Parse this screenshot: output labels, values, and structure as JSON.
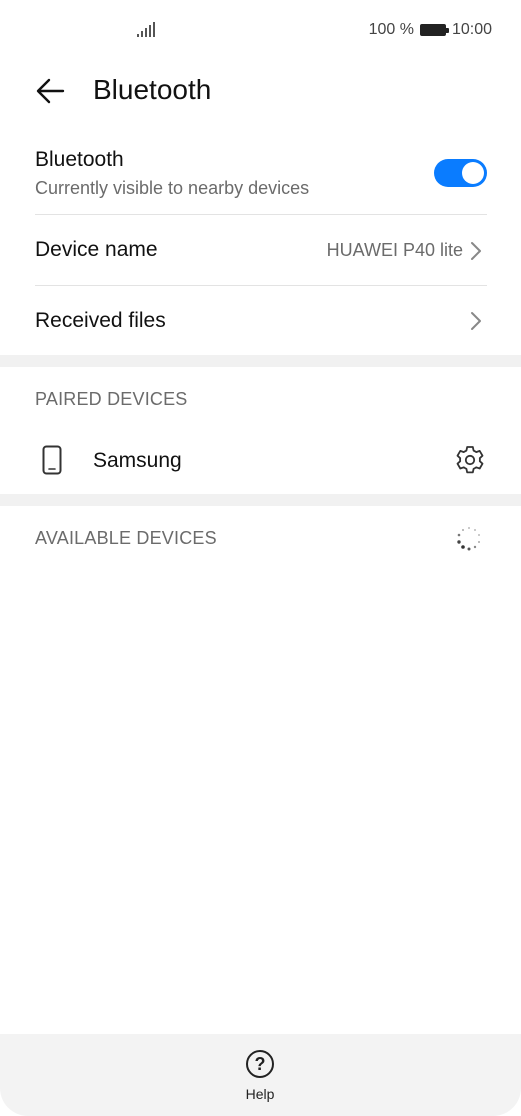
{
  "status_bar": {
    "battery_text": "100 %",
    "time": "10:00"
  },
  "header": {
    "title": "Bluetooth"
  },
  "bluetooth_row": {
    "title": "Bluetooth",
    "subtitle": "Currently visible to nearby devices",
    "enabled": true
  },
  "device_name_row": {
    "label": "Device name",
    "value": "HUAWEI P40 lite"
  },
  "received_files_row": {
    "label": "Received files"
  },
  "paired_section": {
    "label": "PAIRED DEVICES",
    "devices": [
      {
        "name": "Samsung",
        "icon": "phone-icon"
      }
    ]
  },
  "available_section": {
    "label": "AVAILABLE DEVICES"
  },
  "bottom_bar": {
    "help_label": "Help"
  },
  "colors": {
    "accent": "#0a7cff",
    "divider": "#f1f1f1",
    "secondary_text": "#6b6b6b"
  }
}
